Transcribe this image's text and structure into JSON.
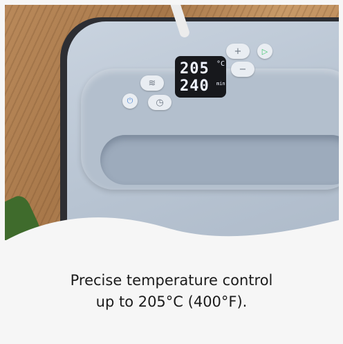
{
  "display": {
    "temp_value": "205",
    "temp_unit": "°C",
    "time_value": "240",
    "time_unit": "min"
  },
  "buttons": {
    "plus_label": "+",
    "minus_label": "−",
    "start_label": "▷",
    "power_label": "⏻",
    "timer_label": "◷",
    "heat_label": "≋"
  },
  "caption": {
    "line1": "Precise temperature control",
    "line2": "up to 205°C (400°F)."
  },
  "colors": {
    "start_accent": "#3cc46a",
    "power_accent": "#5a8fd8"
  }
}
